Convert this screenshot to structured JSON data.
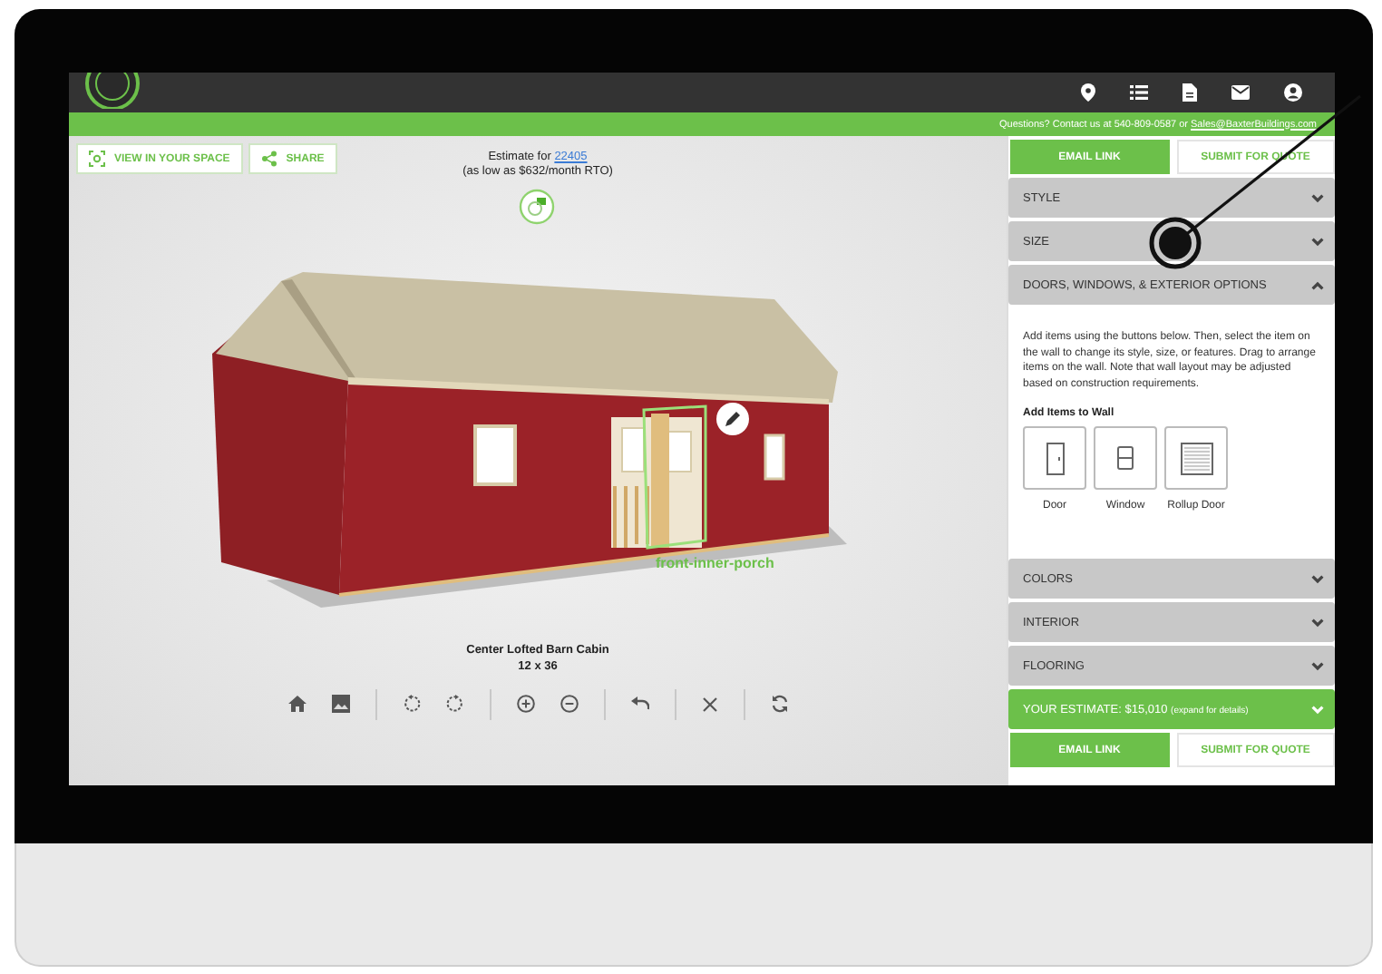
{
  "header": {
    "contact_text": "Questions? Contact us at 540-809-0587 or ",
    "contact_link": "Sales@BaxterBuildings.com"
  },
  "viewer": {
    "buttons": [
      {
        "label": "VIEW IN YOUR SPACE",
        "kind": "ar"
      },
      {
        "label": "SHARE",
        "kind": "share"
      }
    ],
    "estimate_label": "Estimate for",
    "estimate_zip": "22405",
    "estimate_rto": "(as low as $632/month RTO)",
    "selection_label": "front-inner-porch",
    "model_name": "Center Lofted Barn Cabin",
    "model_size": "12 x 36"
  },
  "panel": {
    "top_buttons": [
      {
        "label": "EMAIL LINK",
        "primary": true
      },
      {
        "label": "SUBMIT FOR QUOTE",
        "primary": false
      }
    ],
    "sections": [
      {
        "title": "STYLE",
        "expanded": false
      },
      {
        "title": "SIZE",
        "expanded": false
      },
      {
        "title": "DOORS, WINDOWS, & EXTERIOR OPTIONS",
        "expanded": true,
        "description": "Add items using the buttons below. Then, select the item on the wall to change its style, size, or features. Drag to arrange items on the wall. Note that wall layout may be adjusted based on construction requirements.",
        "items_title": "Add Items to Wall",
        "items": [
          {
            "label": "Door",
            "kind": "door"
          },
          {
            "label": "Window",
            "kind": "window"
          },
          {
            "label": "Rollup Door",
            "kind": "rollup"
          }
        ]
      },
      {
        "title": "COLORS",
        "expanded": false
      },
      {
        "title": "INTERIOR",
        "expanded": false
      },
      {
        "title": "FLOORING",
        "expanded": false
      }
    ],
    "estimate": {
      "title": "YOUR ESTIMATE: $15,010",
      "hint": "(expand for details)",
      "expanded": false
    },
    "bottom_buttons": [
      {
        "label": "EMAIL LINK",
        "primary": true
      },
      {
        "label": "SUBMIT FOR QUOTE",
        "primary": false
      }
    ]
  }
}
